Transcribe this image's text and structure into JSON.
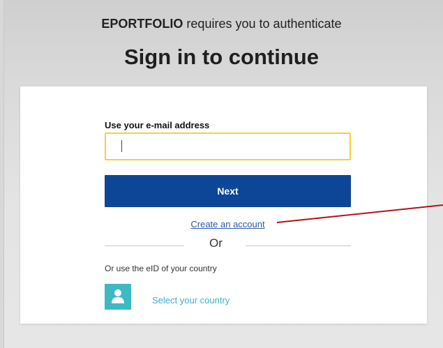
{
  "header": {
    "app_name": "EPORTFOLIO",
    "auth_message": " requires you to authenticate",
    "title": "Sign in to continue"
  },
  "form": {
    "email_label": "Use your e-mail address",
    "email_value": "",
    "email_placeholder": "",
    "next_label": "Next",
    "create_account_label": "Create an account",
    "or_label": "Or",
    "eid_label": "Or use the eID of your country",
    "select_country_label": "Select your country",
    "country_icon": "user-icon"
  },
  "colors": {
    "primary_button": "#0e4697",
    "input_border_focus": "#f6cf3f",
    "link": "#2c5aa8",
    "country_accent": "#3db9c4",
    "annotation_arrow": "#b3121a"
  }
}
